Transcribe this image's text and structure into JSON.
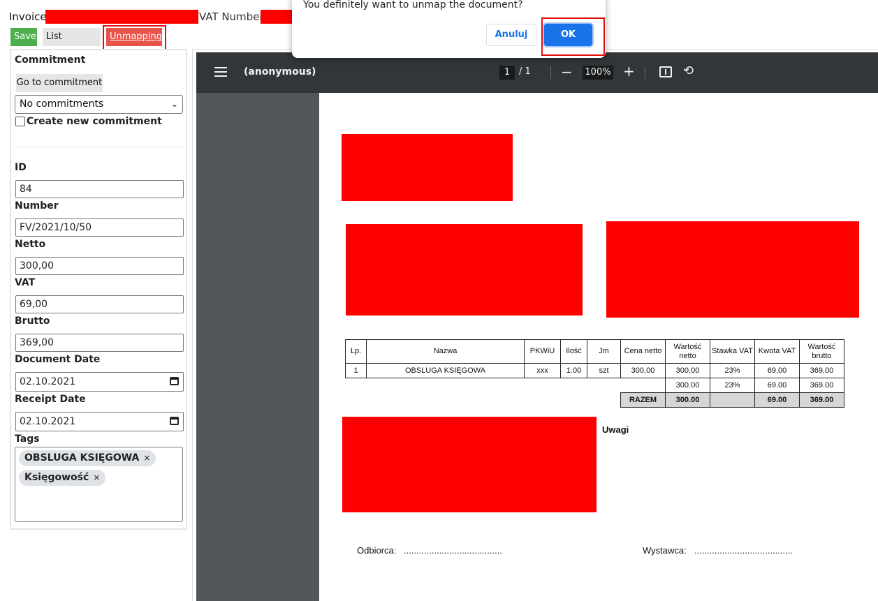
{
  "header": {
    "invoice_label": "Invoice",
    "vat_label": "VAT Number:",
    "save": "Save",
    "list_invoices": "List invoices",
    "unmapping": "Unmapping"
  },
  "form": {
    "commitment_heading": "Commitment",
    "goto_commitment": "Go to commitment",
    "commitment_select": "No commitments",
    "create_new_commitment": "Create new commitment",
    "id_label": "ID",
    "id_value": "84",
    "number_label": "Number",
    "number_value": "FV/2021/10/50",
    "netto_label": "Netto",
    "netto_value": "300,00",
    "vat_label": "VAT",
    "vat_value": "69,00",
    "brutto_label": "Brutto",
    "brutto_value": "369,00",
    "document_date_label": "Document Date",
    "document_date_value": "02.10.2021",
    "receipt_date_label": "Receipt Date",
    "receipt_date_value": "02.10.2021",
    "tags_label": "Tags",
    "tags": [
      "OBSLUGA KSIĘGOWA",
      "Księgowość"
    ]
  },
  "viewer": {
    "title": "(anonymous)",
    "page_current": "1",
    "page_total": "/ 1",
    "zoom": "100%"
  },
  "invoice": {
    "headers": [
      "Lp.",
      "Nazwa",
      "PKWiU",
      "Ilość",
      "Jm",
      "Cena netto",
      "Wartość netto",
      "Stawka VAT",
      "Kwota VAT",
      "Wartość brutto"
    ],
    "row": [
      "1",
      "OBSLUGA KSIĘGOWA",
      "xxx",
      "1.00",
      "szt",
      "300,00",
      "300,00",
      "23%",
      "69,00",
      "369,00"
    ],
    "subtotal": [
      "300.00",
      "23%",
      "69.00",
      "369.00"
    ],
    "total_label": "RAZEM",
    "total": [
      "300.00",
      "",
      "69.00",
      "369.00"
    ],
    "remarks_label": "Uwagi",
    "receiver_label": "Odbiorca:",
    "issuer_label": "Wystawca:",
    "dots": "......................................."
  },
  "dialog": {
    "message": "You definitely want to unmap the document?",
    "cancel": "Anuluj",
    "ok": "OK"
  },
  "colors": {
    "highlight": "#e01010",
    "redaction": "#ff0000",
    "primary": "#1a73e8"
  }
}
